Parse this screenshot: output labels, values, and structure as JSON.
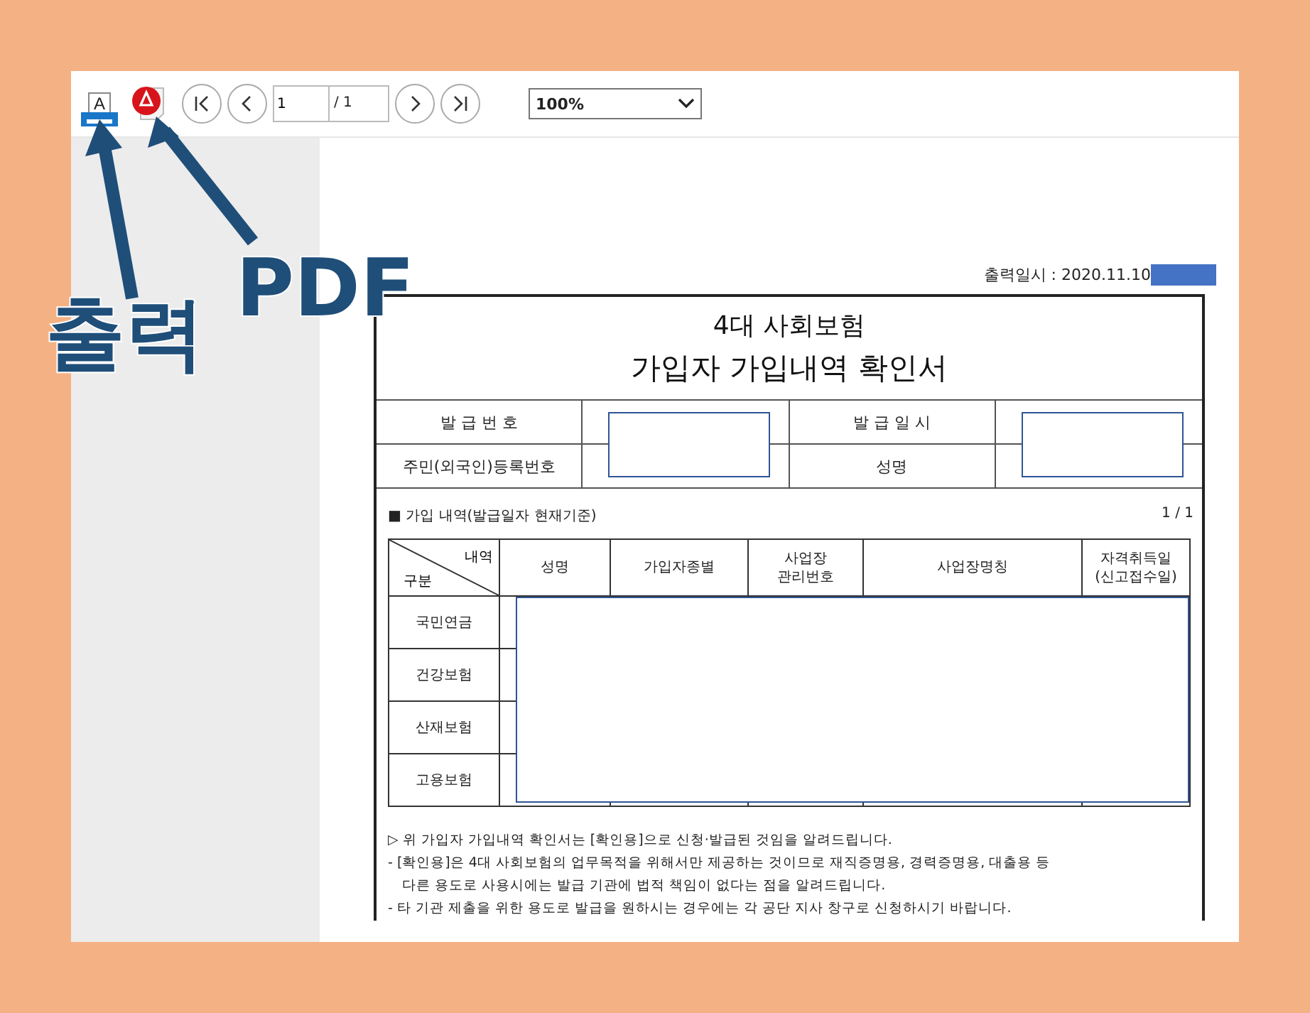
{
  "toolbar": {
    "print_label": "A",
    "page_input": "1",
    "page_total": "/ 1",
    "zoom": "100%"
  },
  "annotations": [
    {
      "text": "출력"
    },
    {
      "text": "PDF"
    }
  ],
  "document": {
    "printed_at": "출력일시 : 2020.11.10",
    "title_line1": "4대 사회보험",
    "title_line2": "가입자 가입내역 확인서",
    "info": [
      {
        "label": "발 급 번 호",
        "label2": "주민(외국인)등록번호"
      },
      {
        "label": "발 급 일 시",
        "label2": "성명"
      }
    ],
    "section_title": "■ 가입 내역(발급일자 현재기준)",
    "page_count": "1   /   1",
    "corner_top": "내역",
    "corner_bottom": "구분",
    "columns": [
      "성명",
      "가입자종별",
      "사업장\n관리번호",
      "사업장명칭",
      "자격취득일\n(신고접수일)"
    ],
    "rows": [
      "국민연금",
      "건강보험",
      "산재보험",
      "고용보험"
    ],
    "notes": [
      "▷ 위 가입자 가입내역 확인서는 [확인용]으로 신청·발급된 것임을 알려드립니다.",
      "- [확인용]은 4대 사회보험의 업무목적을 위해서만 제공하는 것이므로 재직증명용, 경력증명용, 대출용 등",
      "다른 용도로 사용시에는 발급 기관에 법적 책임이 없다는 점을 알려드립니다.",
      "- 타 기관 제출을 위한 용도로 발급을 원하시는 경우에는 각 공단 지사 창구로 신청하시기 바랍니다."
    ]
  }
}
